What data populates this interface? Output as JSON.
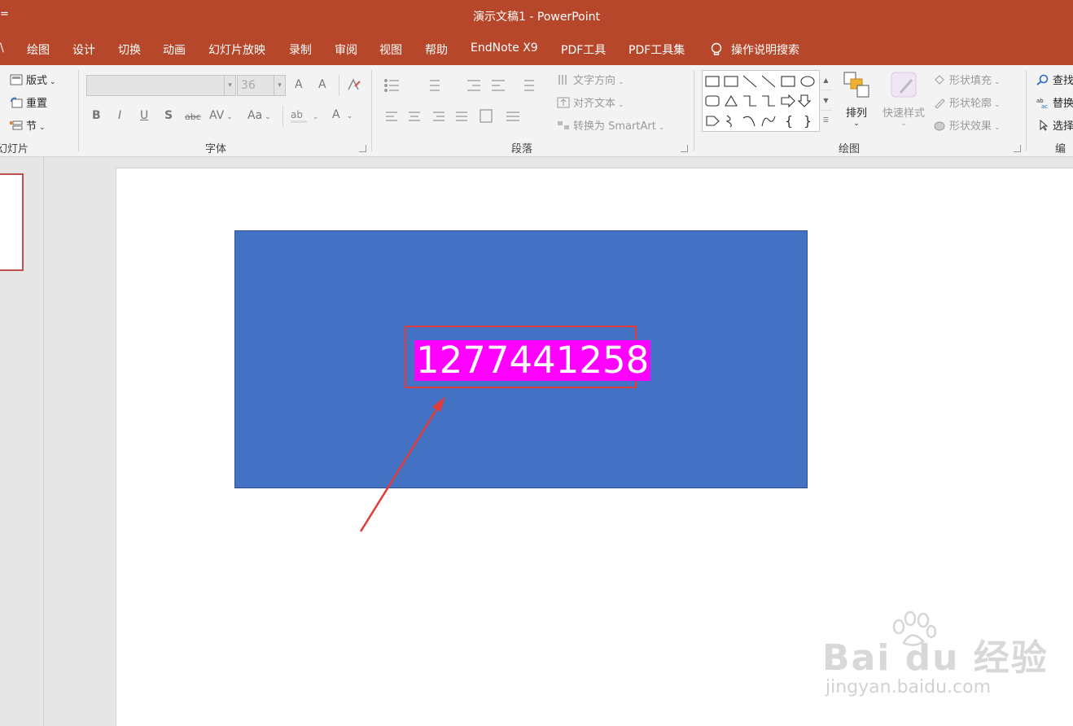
{
  "window": {
    "title": "演示文稿1  -  PowerPoint",
    "lead_glyph": "="
  },
  "menu": {
    "tabs": [
      "\\",
      "绘图",
      "设计",
      "切换",
      "动画",
      "幻灯片放映",
      "录制",
      "审阅",
      "视图",
      "帮助",
      "EndNote X9",
      "PDF工具",
      "PDF工具集"
    ],
    "search": "操作说明搜索"
  },
  "ribbon": {
    "slides_group": {
      "layout": "版式",
      "reset": "重置",
      "section": "节",
      "label": "幻灯片"
    },
    "font_group": {
      "font_name": "",
      "font_size": "36",
      "label": "字体",
      "bold": "B",
      "italic": "I",
      "underline": "U",
      "shadow": "S",
      "strike": "abc",
      "spacing": "AV",
      "case": "Aa",
      "grow": "A",
      "shrink": "A",
      "color": "A"
    },
    "paragraph_group": {
      "text_direction": "文字方向",
      "align_text": "对齐文本",
      "smartart": "转换为 SmartArt",
      "label": "段落"
    },
    "drawing_group": {
      "arrange": "排列",
      "quick_styles": "快速样式",
      "fill": "形状填充",
      "outline": "形状轮廓",
      "effects": "形状效果",
      "label": "绘图"
    },
    "editing_group": {
      "find": "查找",
      "replace": "替换",
      "select": "选择",
      "label": "编辑"
    }
  },
  "slide": {
    "textbox_text": "1277441258",
    "shape_color": "#4472c4",
    "highlight_color": "#ff00ff",
    "annotation_color": "#e03c3c"
  },
  "watermark": {
    "brand": "Bai du 经验",
    "url": "jingyan.baidu.com"
  }
}
